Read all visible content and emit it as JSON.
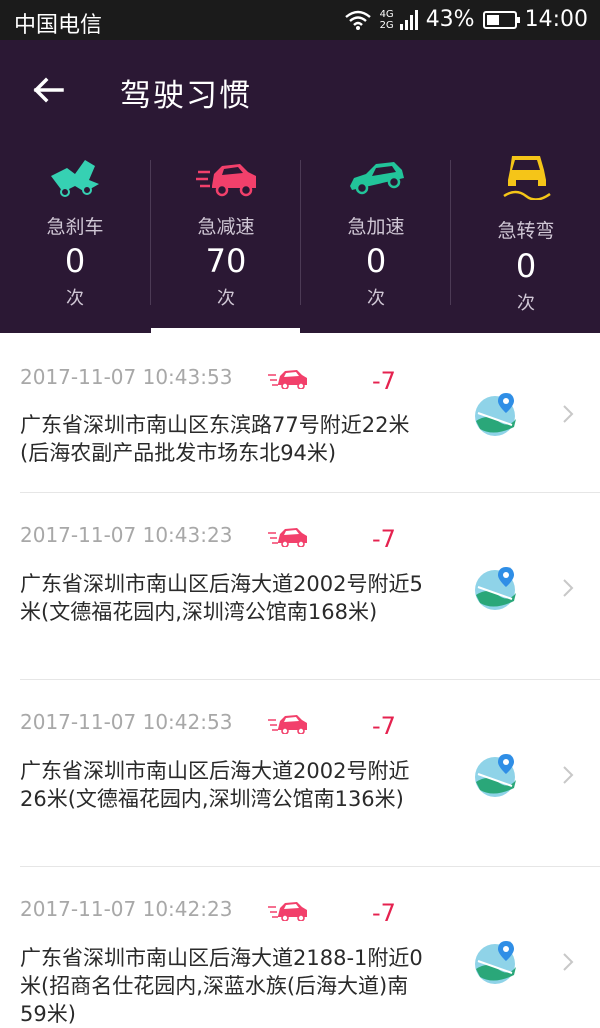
{
  "status_bar": {
    "carrier": "中国电信",
    "network_top": "4G",
    "network_bottom": "2G",
    "battery": "43%",
    "time": "14:00",
    "icons": [
      "wifi-icon",
      "signal-icon",
      "battery-icon"
    ]
  },
  "header": {
    "title": "驾驶习惯",
    "back_icon": "arrow-left-icon",
    "background": "#2b1834"
  },
  "stats": [
    {
      "label": "急刹车",
      "value": "0",
      "unit": "次",
      "icon": "hard-brake-icon",
      "color": "#36d1b3"
    },
    {
      "label": "急减速",
      "value": "70",
      "unit": "次",
      "icon": "hard-decel-icon",
      "color": "#f2406b"
    },
    {
      "label": "急加速",
      "value": "0",
      "unit": "次",
      "icon": "hard-accel-icon",
      "color": "#22c49a"
    },
    {
      "label": "急转弯",
      "value": "0",
      "unit": "次",
      "icon": "sharp-turn-icon",
      "color": "#f5c518"
    }
  ],
  "selected_tab": "急减速",
  "records": [
    {
      "time": "2017-11-07 10:43:53",
      "score": "-7",
      "address": "广东省深圳市南山区东滨路77号附近22米(后海农副产品批发市场东北94米)"
    },
    {
      "time": "2017-11-07 10:43:23",
      "score": "-7",
      "address": "广东省深圳市南山区后海大道2002号附近5米(文德福花园内,深圳湾公馆南168米)"
    },
    {
      "time": "2017-11-07 10:42:53",
      "score": "-7",
      "address": "广东省深圳市南山区后海大道2002号附近26米(文德福花园内,深圳湾公馆南136米)"
    },
    {
      "time": "2017-11-07 10:42:23",
      "score": "-7",
      "address": "广东省深圳市南山区后海大道2188-1附近0米(招商名仕花园内,深蓝水族(后海大道)南59米)"
    }
  ],
  "colors": {
    "accent": "#e5224f",
    "timestamp": "#a8a8a8",
    "text": "#2a2a2a"
  }
}
